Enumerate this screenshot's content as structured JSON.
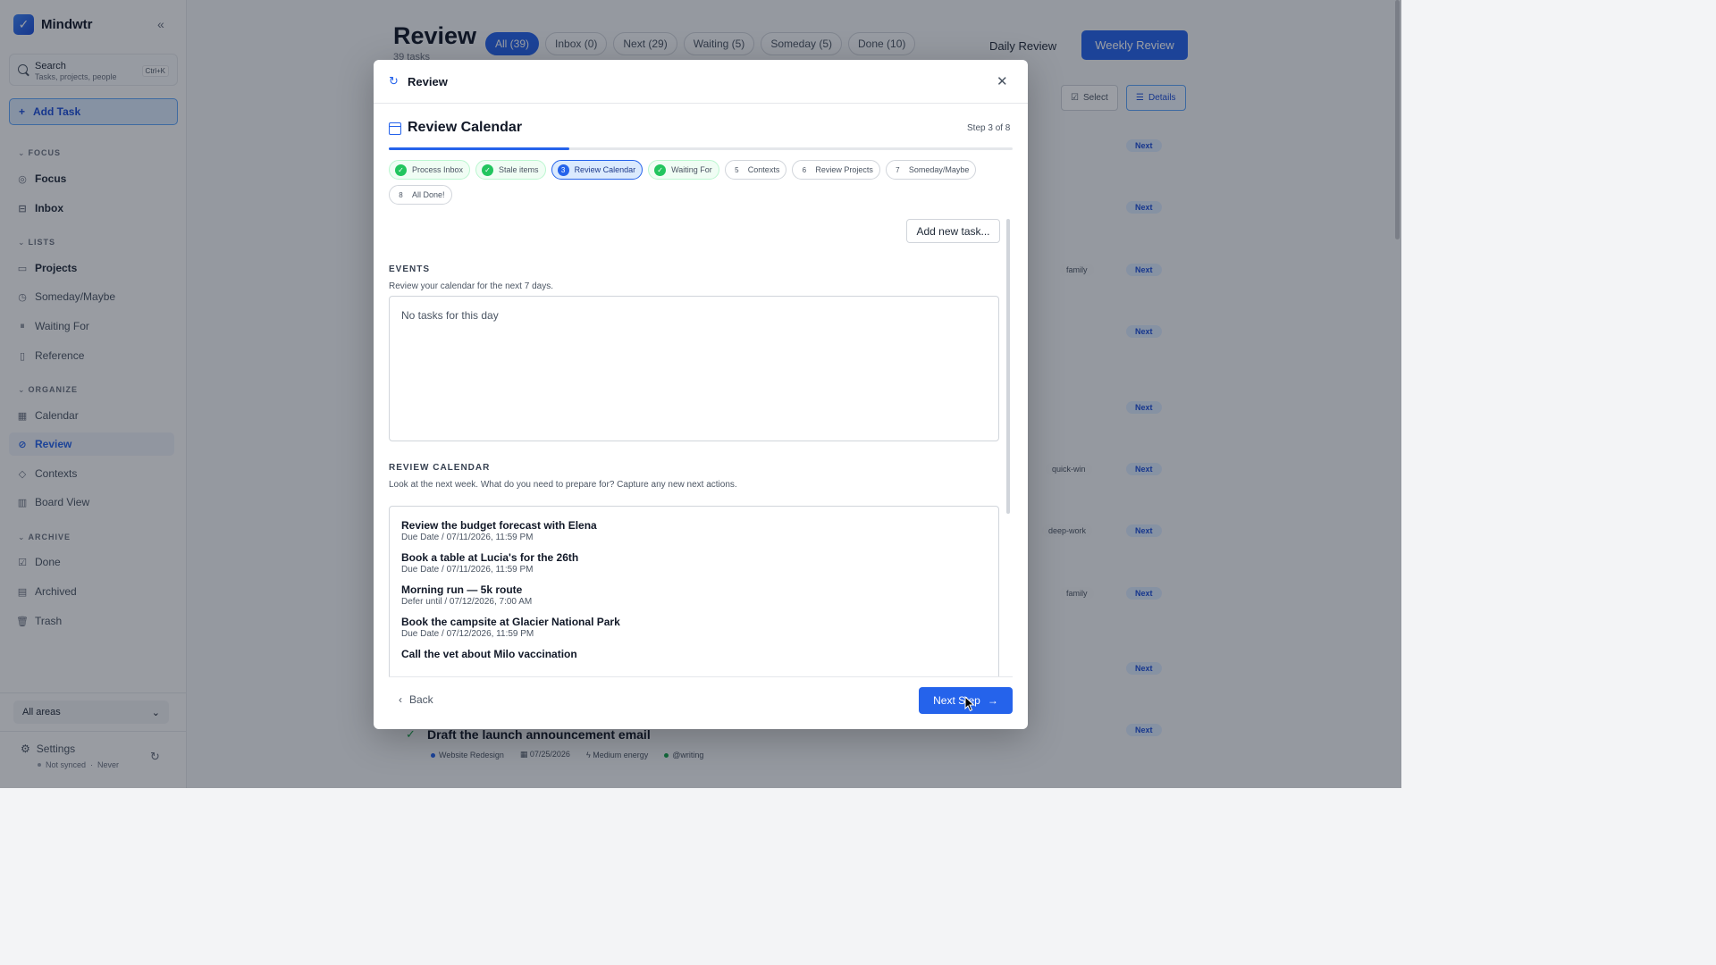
{
  "app": {
    "name": "Mindwtr",
    "logo_glyph": "✓",
    "collapse_glyph": "«"
  },
  "sidebar": {
    "search": {
      "title": "Search",
      "subtitle": "Tasks, projects, people",
      "shortcut": "Ctrl+K"
    },
    "add_task": "Add Task",
    "sections": {
      "focus": "FOCUS",
      "lists": "LISTS",
      "organize": "ORGANIZE",
      "archive": "ARCHIVE"
    },
    "items": {
      "focus": "Focus",
      "inbox": "Inbox",
      "projects": "Projects",
      "someday": "Someday/Maybe",
      "waiting": "Waiting For",
      "reference": "Reference",
      "calendar": "Calendar",
      "review": "Review",
      "contexts": "Contexts",
      "board": "Board View",
      "done": "Done",
      "archived": "Archived",
      "trash": "Trash"
    },
    "areas_select": "All areas",
    "settings": "Settings",
    "sync_status": "Not synced",
    "sync_time": "Never"
  },
  "main": {
    "title": "Review",
    "subtitle": "39 tasks",
    "filter_tabs": [
      "All (39)",
      "Inbox (0)",
      "Next (29)",
      "Waiting (5)",
      "Someday (5)",
      "Done (10)"
    ],
    "active_tab": "All (39)",
    "daily_review": "Daily Review",
    "weekly_review": "Weekly Review",
    "toolbar": {
      "select": "Select",
      "details": "Details"
    },
    "row_badges": [
      "Next",
      "Next",
      "Next",
      "Next",
      "Next",
      "Next",
      "Next",
      "Next",
      "Next",
      "Next"
    ],
    "row_tags": [
      "family",
      "quick-win",
      "deep-work",
      "family"
    ],
    "bottom_task": {
      "title": "Draft the launch announcement email",
      "project": "Website Redesign",
      "date": "07/25/2026",
      "energy": "Medium energy",
      "context": "@writing"
    }
  },
  "modal": {
    "title": "Review",
    "step_title": "Review Calendar",
    "step_count": "Step 3 of 8",
    "progress_fraction": 0.29,
    "steps": [
      {
        "num": "1",
        "label": "Process Inbox",
        "state": "done"
      },
      {
        "num": "2",
        "label": "Stale items",
        "state": "done"
      },
      {
        "num": "3",
        "label": "Review Calendar",
        "state": "current"
      },
      {
        "num": "4",
        "label": "Waiting For",
        "state": "done"
      },
      {
        "num": "5",
        "label": "Contexts",
        "state": "todo"
      },
      {
        "num": "6",
        "label": "Review Projects",
        "state": "todo"
      },
      {
        "num": "7",
        "label": "Someday/Maybe",
        "state": "todo"
      },
      {
        "num": "8",
        "label": "All Done!",
        "state": "todo"
      }
    ],
    "add_new_task": "Add new task...",
    "events_label": "EVENTS",
    "events_desc": "Review your calendar for the next 7 days.",
    "events_empty": "No tasks for this day",
    "calendar_label": "REVIEW CALENDAR",
    "calendar_desc": "Look at the next week. What do you need to prepare for? Capture any new next actions.",
    "calendar_items": [
      {
        "title": "Review the budget forecast with Elena",
        "detail": "Due Date / 07/11/2026, 11:59 PM"
      },
      {
        "title": "Book a table at Lucia's for the 26th",
        "detail": "Due Date / 07/11/2026, 11:59 PM"
      },
      {
        "title": "Morning run — 5k route",
        "detail": "Defer until / 07/12/2026, 7:00 AM"
      },
      {
        "title": "Book the campsite at Glacier National Park",
        "detail": "Due Date / 07/12/2026, 11:59 PM"
      },
      {
        "title": "Call the vet about Milo vaccination",
        "detail": ""
      }
    ],
    "back": "Back",
    "next_step": "Next Step"
  },
  "colors": {
    "accent": "#2563eb",
    "done_green": "#22c55e"
  }
}
